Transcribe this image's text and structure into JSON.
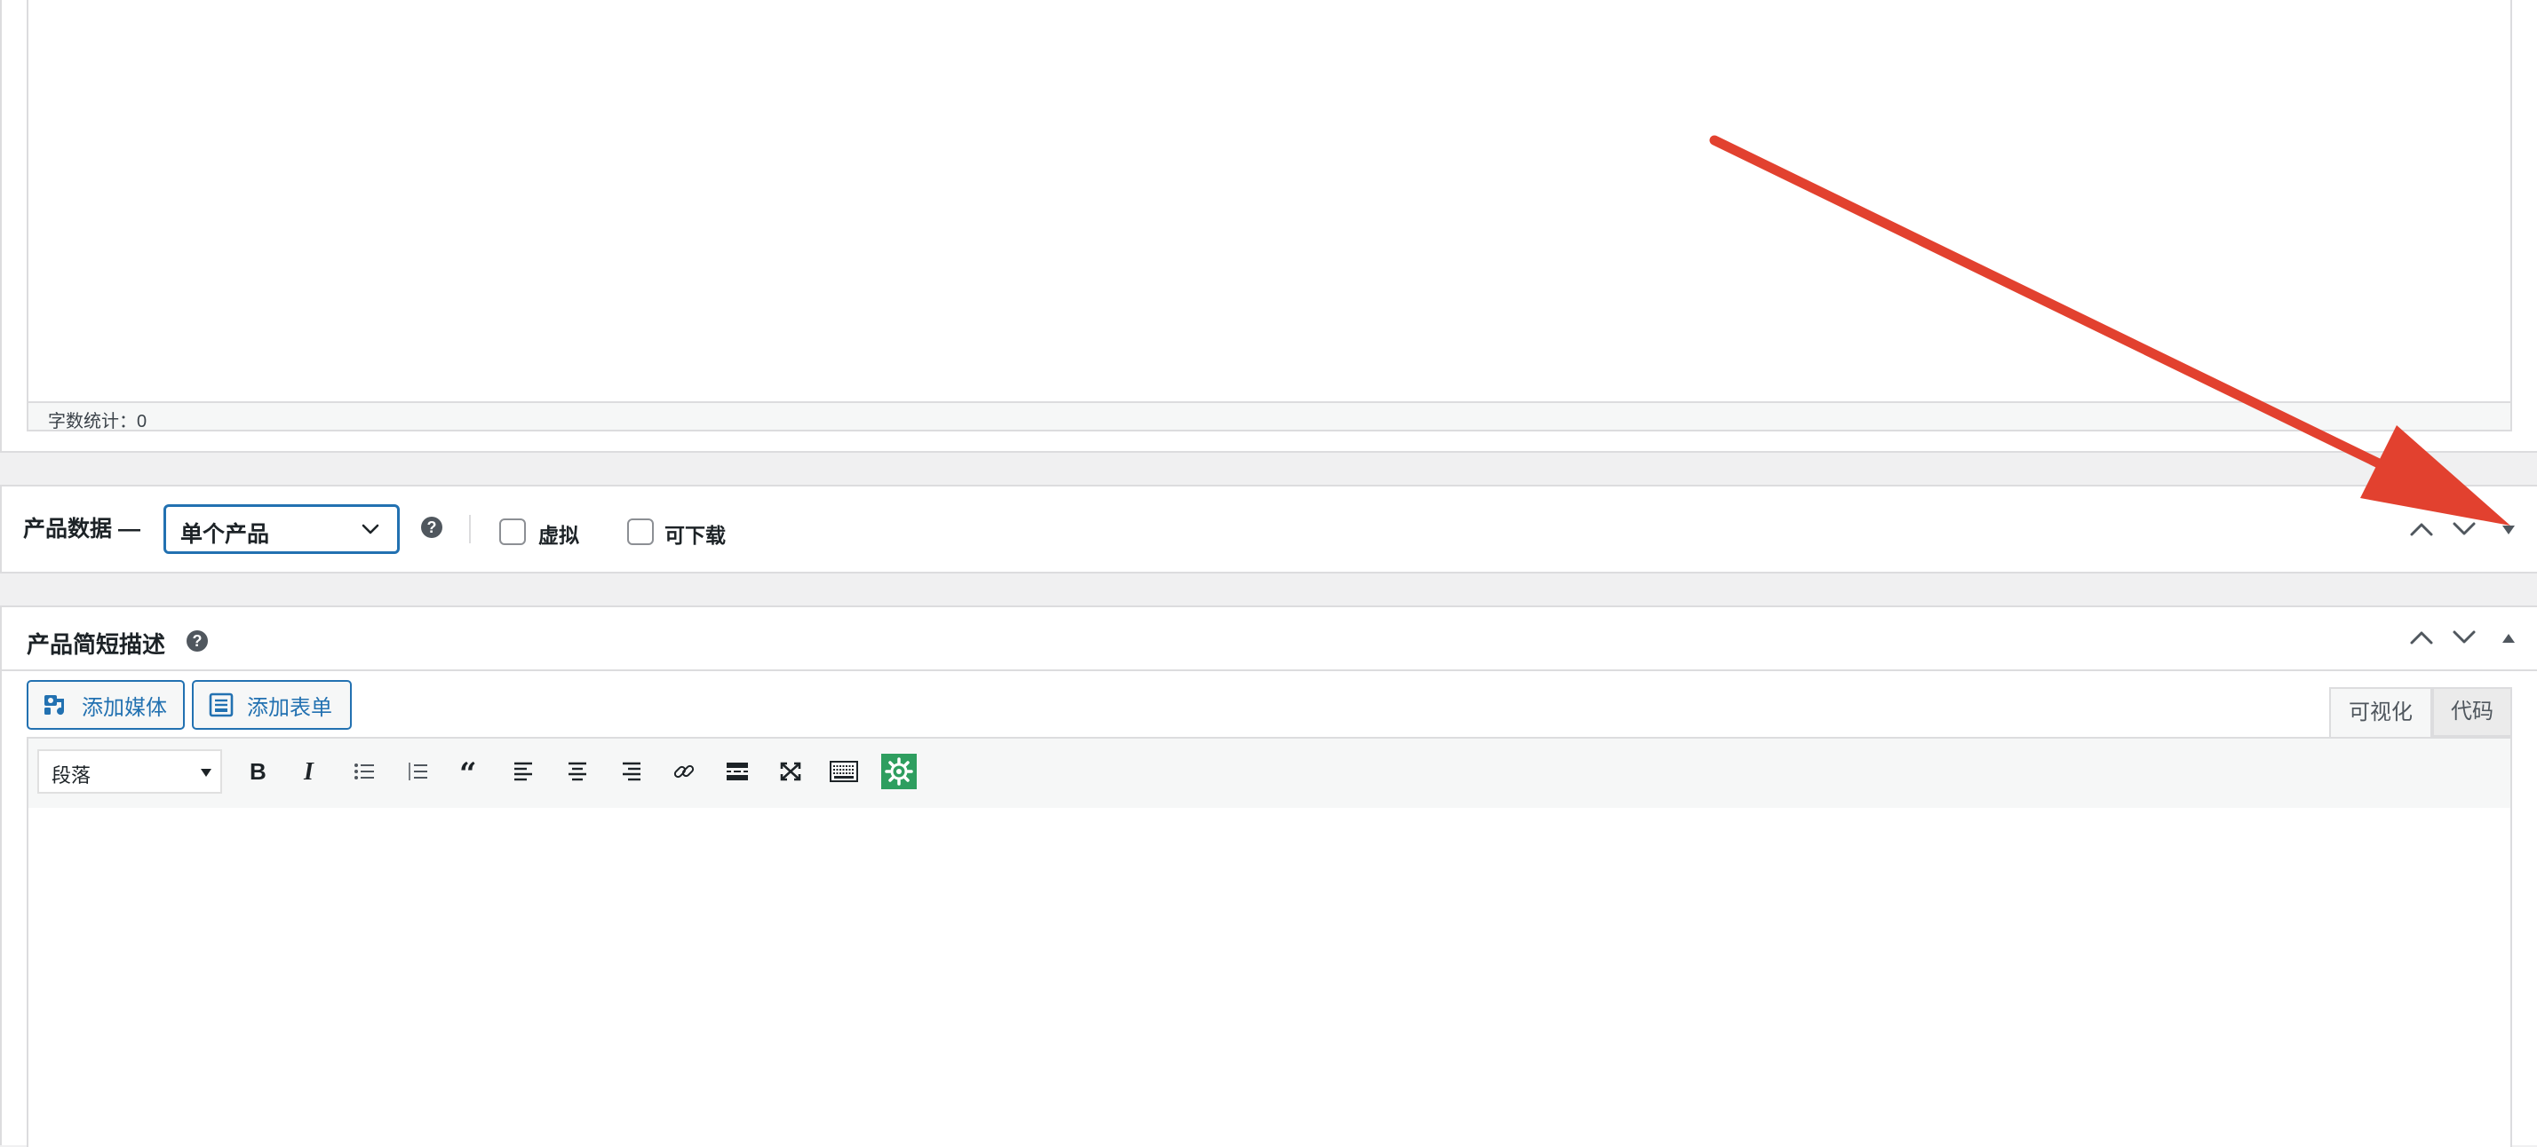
{
  "top_editor": {
    "word_count_label": "字数统计：0"
  },
  "product_data": {
    "title": "产品数据 —",
    "product_type": {
      "selected": "单个产品"
    },
    "virtual_label": "虚拟",
    "downloadable_label": "可下载",
    "controls": [
      "chevron-up-icon",
      "chevron-down-icon",
      "toggle-arrow-icon"
    ]
  },
  "short_description": {
    "title": "产品简短描述",
    "add_media_label": "添加媒体",
    "add_form_label": "添加表单",
    "tabs": {
      "visual": "可视化",
      "code": "代码"
    },
    "toolbar": {
      "format_value": "段落",
      "buttons": [
        "bold-icon",
        "italic-icon",
        "bulleted-list-icon",
        "numbered-list-icon",
        "blockquote-icon",
        "align-left-icon",
        "align-center-icon",
        "align-right-icon",
        "link-icon",
        "read-more-icon",
        "fullscreen-icon",
        "keyboard-icon",
        "plugin-gear-icon"
      ]
    }
  },
  "annotation": {
    "color": "#e2412f",
    "icon": "red-arrow-pointer"
  },
  "colors": {
    "accent": "#2271b1",
    "border": "#dcdcde",
    "page_background": "#f0f0f1",
    "plugin_green": "#2e9e5f"
  }
}
